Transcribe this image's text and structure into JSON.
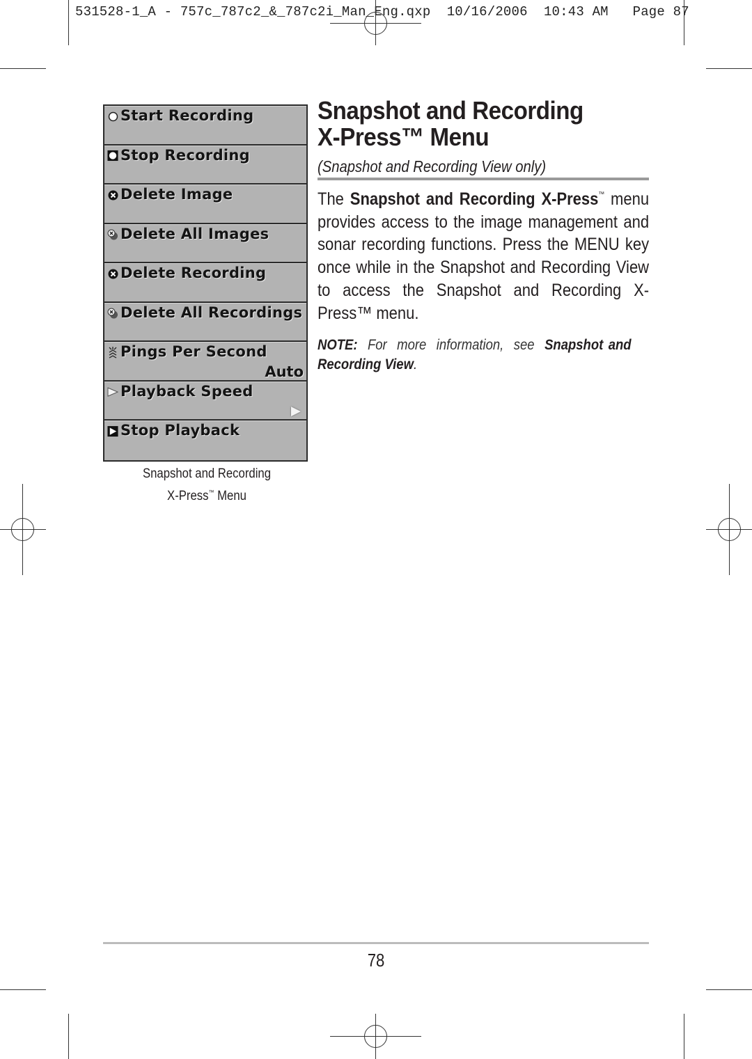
{
  "slug_line": {
    "file": "531528-1_A - 757c_787c2_&_787c2i_Man_Eng.qxp",
    "date": "10/16/2006",
    "time": "10:43 AM",
    "page": "Page 87"
  },
  "menu": {
    "items": [
      {
        "label": "Start Recording",
        "icon": "circle-icon",
        "value": ""
      },
      {
        "label": "Stop Recording",
        "icon": "stop-square-icon",
        "value": ""
      },
      {
        "label": "Delete Image",
        "icon": "delete-x-icon",
        "value": ""
      },
      {
        "label": "Delete All Images",
        "icon": "delete-all-icon",
        "value": ""
      },
      {
        "label": "Delete Recording",
        "icon": "delete-x-icon",
        "value": ""
      },
      {
        "label": "Delete All Recordings",
        "icon": "delete-all-icon",
        "value": ""
      },
      {
        "label": "Pings Per Second",
        "icon": "pings-icon",
        "value": "Auto"
      },
      {
        "label": "Playback Speed",
        "icon": "play-triangle-icon",
        "value": "▷"
      },
      {
        "label": "Stop Playback",
        "icon": "play-square-icon",
        "value": ""
      }
    ]
  },
  "caption": {
    "line1": "Snapshot and Recording",
    "line2_main": "X-Press",
    "line2_tm": "™",
    "line2_end": " Menu"
  },
  "heading": {
    "line1": "Snapshot and Recording",
    "line2": "X-Press™ Menu",
    "subtitle": "(Snapshot and Recording View only)"
  },
  "body": {
    "intro": "The ",
    "bold": "Snapshot and Recording X-Press",
    "tm": "™",
    "rest": " menu provides access to the image management and sonar recording functions. Press the MENU key once while in the Snapshot and Recording View to access the Snapshot and Recording X-Press™ menu."
  },
  "note": {
    "label": "NOTE:",
    "text": " For more information, see ",
    "link": "Snapshot and Recording View",
    "end": "."
  },
  "footer": {
    "page_number": "78"
  }
}
